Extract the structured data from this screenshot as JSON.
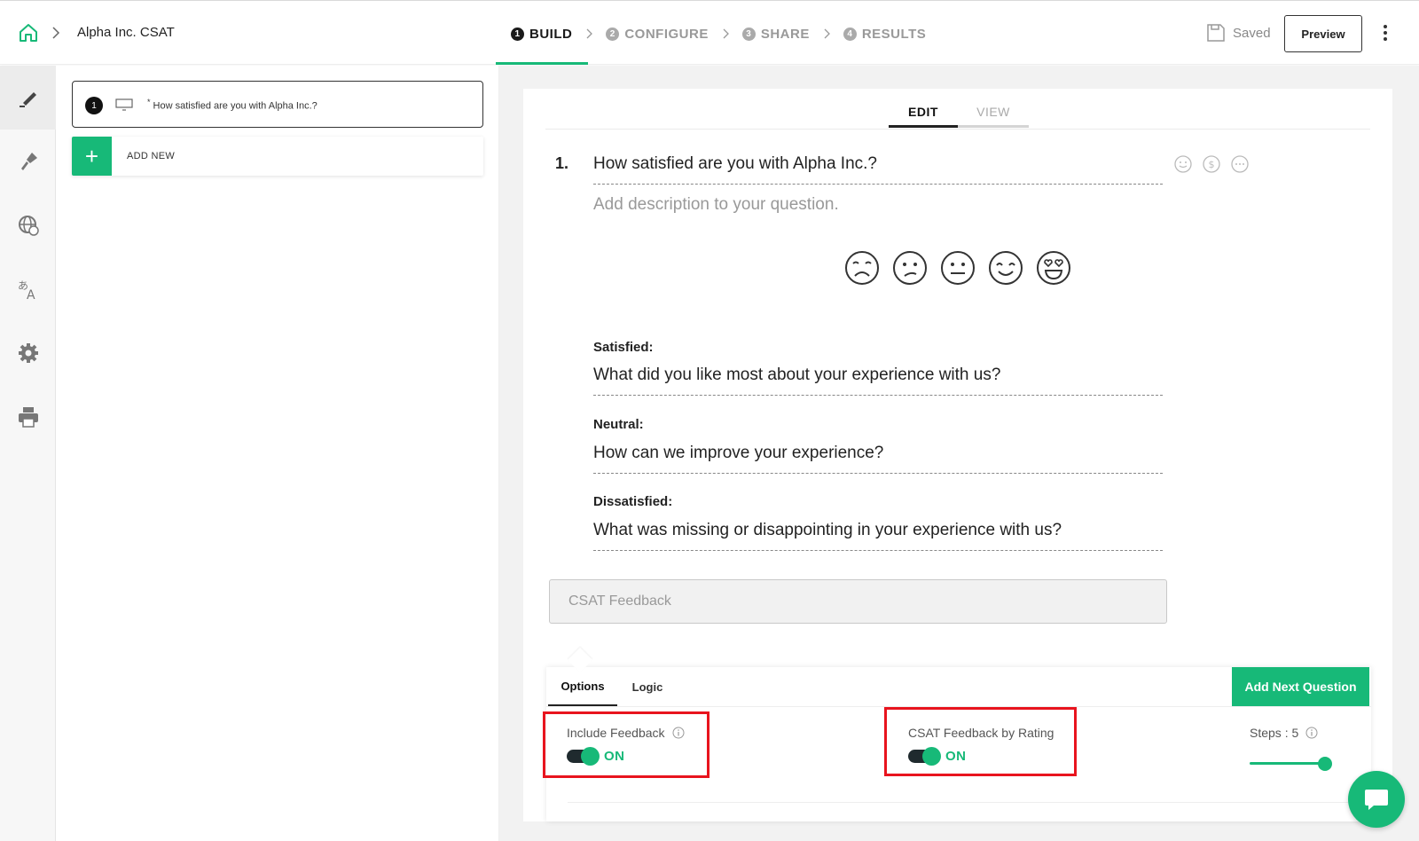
{
  "header": {
    "project_title": "Alpha Inc. CSAT",
    "steps": [
      {
        "num": "1",
        "label": "BUILD"
      },
      {
        "num": "2",
        "label": "CONFIGURE"
      },
      {
        "num": "3",
        "label": "SHARE"
      },
      {
        "num": "4",
        "label": "RESULTS"
      }
    ],
    "active_step": "BUILD",
    "saved_label": "Saved",
    "preview_label": "Preview"
  },
  "rail": {
    "items": [
      {
        "icon": "pen-icon"
      },
      {
        "icon": "paint-brush-icon"
      },
      {
        "icon": "globe-icon"
      },
      {
        "icon": "translate-icon"
      },
      {
        "icon": "gear-icon"
      },
      {
        "icon": "printer-icon"
      }
    ]
  },
  "question_list": {
    "items": [
      {
        "number": "1",
        "required_mark": "*",
        "text": "How satisfied are you with Alpha Inc.?"
      }
    ],
    "add_new_label": "ADD NEW"
  },
  "editor": {
    "tabs": {
      "edit": "EDIT",
      "view": "VIEW"
    },
    "question_number": "1.",
    "question_title": "How satisfied are you with Alpha Inc.?",
    "description_placeholder": "Add description to your question.",
    "faces": [
      "very-dissatisfied-face-icon",
      "dissatisfied-face-icon",
      "neutral-face-icon",
      "satisfied-face-icon",
      "very-satisfied-face-icon"
    ],
    "feedback": [
      {
        "label": "Satisfied:",
        "text": "What did you like most about your experience with us?"
      },
      {
        "label": "Neutral:",
        "text": "How can we improve your experience?"
      },
      {
        "label": "Dissatisfied:",
        "text": "What was missing or disappointing in your experience with us?"
      }
    ],
    "feedback_input_placeholder": "CSAT Feedback"
  },
  "options_panel": {
    "tabs": {
      "options": "Options",
      "logic": "Logic"
    },
    "add_next_question": "Add Next Question",
    "include_feedback": {
      "label": "Include Feedback",
      "state": "ON"
    },
    "csat_feedback_by_rating": {
      "label": "CSAT Feedback by Rating",
      "state": "ON"
    },
    "steps": {
      "label": "Steps : 5",
      "value": 5
    }
  },
  "colors": {
    "accent": "#17b978",
    "highlight": "#e8141e"
  }
}
